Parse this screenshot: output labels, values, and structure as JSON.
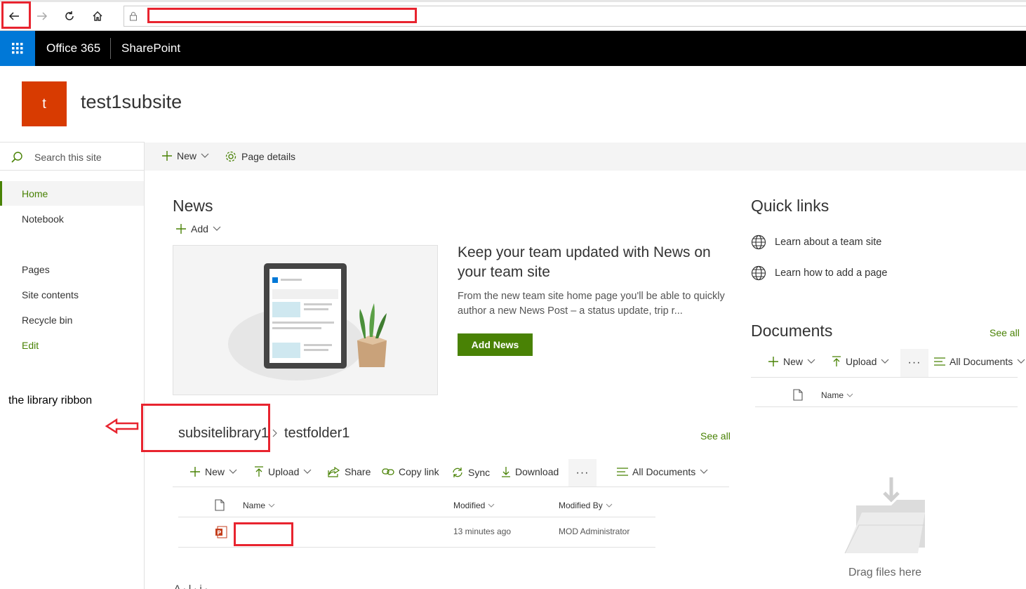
{
  "browser": {
    "back_icon": "arrow-left-icon",
    "forward_icon": "arrow-right-icon",
    "refresh_icon": "refresh-icon",
    "home_icon": "home-icon",
    "lock_icon": "lock-icon",
    "address": ""
  },
  "suite_bar": {
    "app_launcher_icon": "waffle-icon",
    "brand": "Office 365",
    "app": "SharePoint"
  },
  "site": {
    "logo_letter": "t",
    "title": "test1subsite"
  },
  "left_nav": {
    "search_placeholder": "Search this site",
    "items": [
      "Home",
      "Notebook",
      "Pages",
      "Site contents",
      "Recycle bin",
      "Edit"
    ]
  },
  "command_bar": {
    "new_label": "New",
    "page_details_label": "Page details"
  },
  "news": {
    "title": "News",
    "add_label": "Add",
    "headline": "Keep your team updated with News on your team site",
    "description": "From the new team site home page you'll be able to quickly author a new News Post – a status update, trip r...",
    "add_news_button": "Add News"
  },
  "quick_links": {
    "title": "Quick links",
    "links": [
      "Learn about a team site",
      "Learn how to add a page"
    ]
  },
  "documents": {
    "title": "Documents",
    "see_all": "See all",
    "new_label": "New",
    "upload_label": "Upload",
    "more_label": "···",
    "view_label": "All Documents",
    "col_name": "Name",
    "empty_text": "Drag files here"
  },
  "library": {
    "breadcrumb_library": "subsitelibrary1",
    "breadcrumb_folder": "testfolder1",
    "see_all": "See all",
    "toolbar": {
      "new": "New",
      "upload": "Upload",
      "share": "Share",
      "copy_link": "Copy link",
      "sync": "Sync",
      "download": "Download",
      "more": "···",
      "view": "All Documents"
    },
    "columns": [
      "Name",
      "Modified",
      "Modified By"
    ],
    "rows": [
      {
        "name": "",
        "modified": "13 minutes ago",
        "modified_by": "MOD Administrator"
      }
    ]
  },
  "annotation": {
    "text": "the library ribbon",
    "color": "#e8242f"
  },
  "bottom_partial_text": "A  ·  l  ·  i  ·"
}
